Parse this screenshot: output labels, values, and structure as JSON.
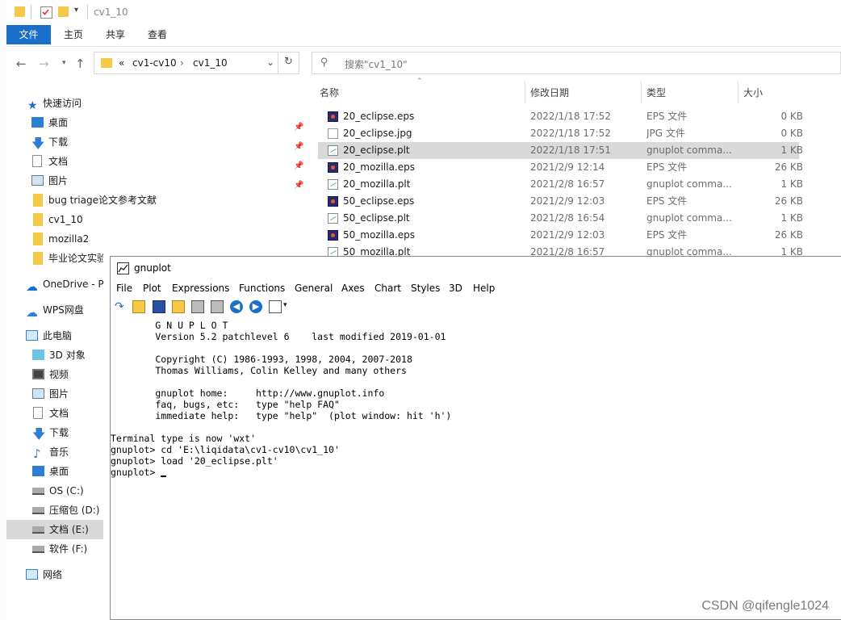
{
  "window": {
    "title": "cv1_10"
  },
  "ribbon": {
    "tabs": [
      "文件",
      "主页",
      "共享",
      "查看"
    ]
  },
  "address": {
    "parts": [
      "«",
      "cv1-cv10",
      "›",
      "cv1_10"
    ],
    "search_placeholder": "搜索\"cv1_10\""
  },
  "nav": {
    "quick_access": "快速访问",
    "pinned": [
      "桌面",
      "下载",
      "文档",
      "图片"
    ],
    "folders": [
      "bug triage论文参考文献",
      "cv1_10",
      "mozilla2",
      "毕业论文实验"
    ],
    "onedrive": "OneDrive - P",
    "wps": "WPS网盘",
    "this_pc": "此电脑",
    "pc_items": [
      "3D 对象",
      "视频",
      "图片",
      "文档",
      "下载",
      "音乐",
      "桌面",
      "OS (C:)",
      "压缩包 (D:)",
      "文档 (E:)",
      "软件 (F:)"
    ],
    "network": "网络"
  },
  "columns": {
    "name": "名称",
    "date": "修改日期",
    "type": "类型",
    "size": "大小"
  },
  "files": [
    {
      "name": "20_eclipse.eps",
      "date": "2022/1/18 17:52",
      "type": "EPS 文件",
      "size": "0 KB",
      "icon": "eps"
    },
    {
      "name": "20_eclipse.jpg",
      "date": "2022/1/18 17:52",
      "type": "JPG 文件",
      "size": "0 KB",
      "icon": "jpg"
    },
    {
      "name": "20_eclipse.plt",
      "date": "2022/1/18 17:51",
      "type": "gnuplot comma...",
      "size": "1 KB",
      "icon": "plt",
      "selected": true
    },
    {
      "name": "20_mozilla.eps",
      "date": "2021/2/9 12:14",
      "type": "EPS 文件",
      "size": "26 KB",
      "icon": "eps"
    },
    {
      "name": "20_mozilla.plt",
      "date": "2021/2/8 16:57",
      "type": "gnuplot comma...",
      "size": "1 KB",
      "icon": "plt"
    },
    {
      "name": "50_eclipse.eps",
      "date": "2021/2/9 12:03",
      "type": "EPS 文件",
      "size": "26 KB",
      "icon": "eps"
    },
    {
      "name": "50_eclipse.plt",
      "date": "2021/2/8 16:54",
      "type": "gnuplot comma...",
      "size": "1 KB",
      "icon": "plt"
    },
    {
      "name": "50_mozilla.eps",
      "date": "2021/2/9 12:03",
      "type": "EPS 文件",
      "size": "26 KB",
      "icon": "eps"
    },
    {
      "name": "50_mozilla.plt",
      "date": "2021/2/8 16:57",
      "type": "gnuplot comma...",
      "size": "1 KB",
      "icon": "plt"
    }
  ],
  "gnuplot": {
    "title": "gnuplot",
    "menu": [
      "File",
      "Plot",
      "Expressions",
      "Functions",
      "General",
      "Axes",
      "Chart",
      "Styles",
      "3D",
      "Help"
    ],
    "console": [
      "        G N U P L O T",
      "        Version 5.2 patchlevel 6    last modified 2019-01-01",
      "",
      "        Copyright (C) 1986-1993, 1998, 2004, 2007-2018",
      "        Thomas Williams, Colin Kelley and many others",
      "",
      "        gnuplot home:     http://www.gnuplot.info",
      "        faq, bugs, etc:   type \"help FAQ\"",
      "        immediate help:   type \"help\"  (plot window: hit 'h')",
      "",
      "Terminal type is now 'wxt'",
      "gnuplot> cd 'E:\\liqidata\\cv1-cv10\\cv1_10'",
      "gnuplot> load '20_eclipse.plt'",
      "gnuplot> "
    ]
  },
  "watermark": "CSDN @qifengle1024",
  "colors": {
    "accent": "#1a6fc9",
    "selection": "#d9d9d9",
    "folder": "#f6c94a"
  }
}
